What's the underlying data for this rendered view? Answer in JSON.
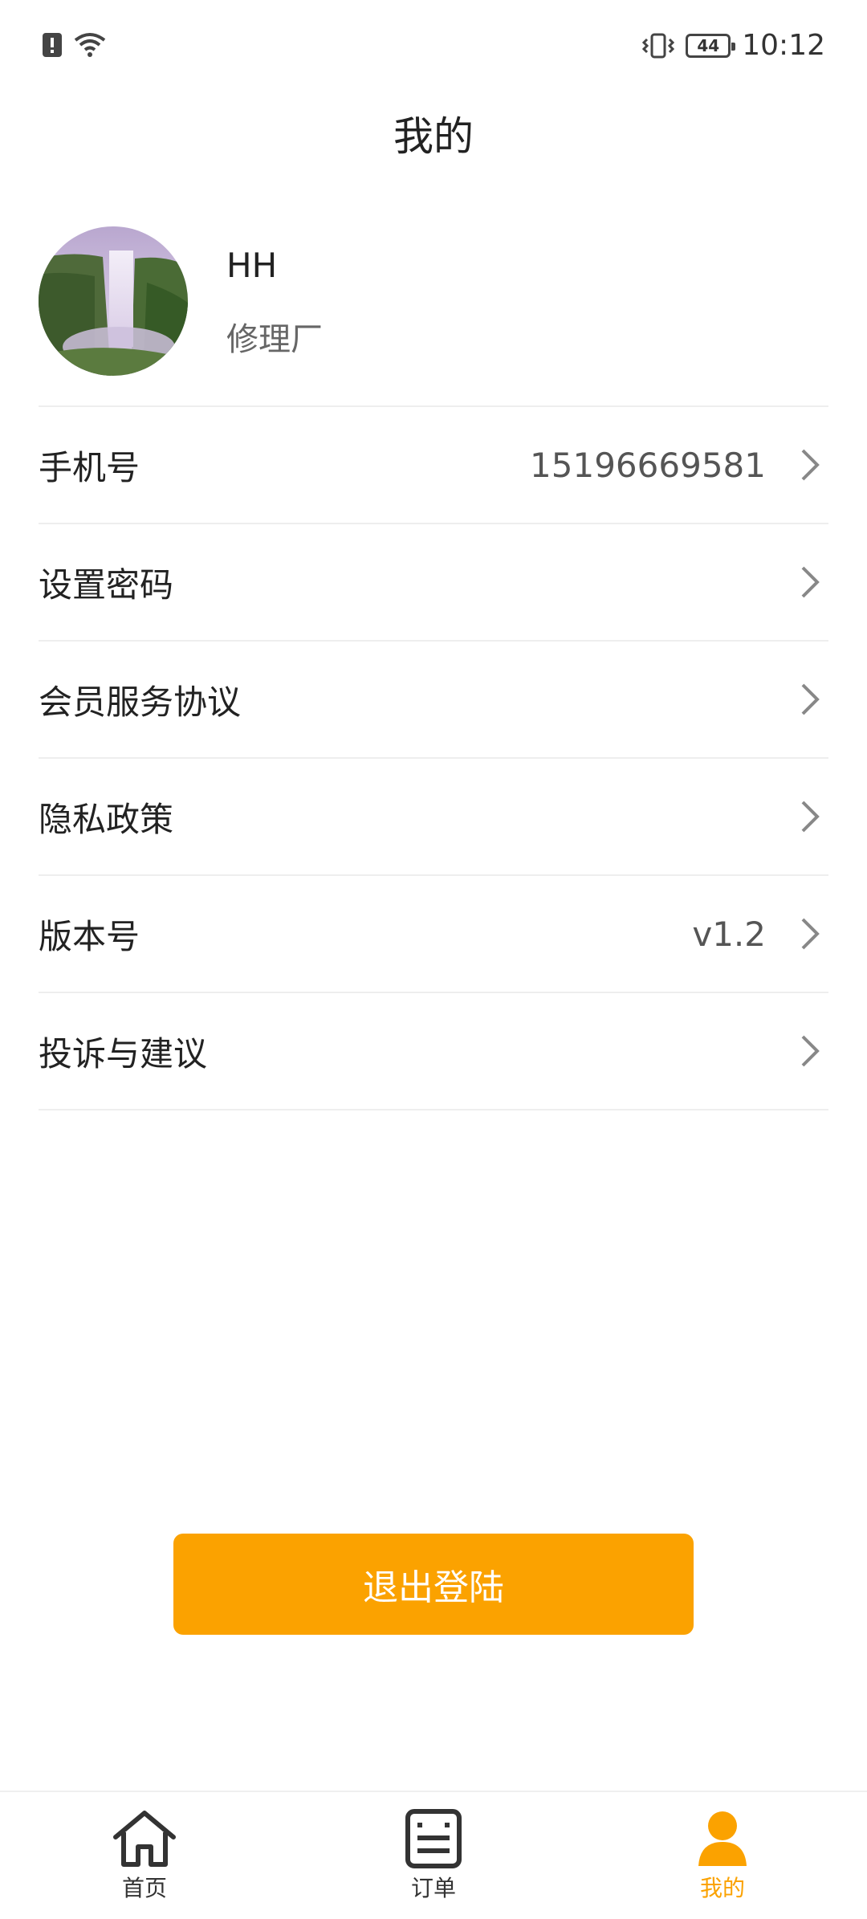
{
  "status_bar": {
    "time": "10:12",
    "battery_level": "44",
    "icons": [
      "alert-icon",
      "wifi-icon",
      "vibrate-icon",
      "battery-icon"
    ]
  },
  "page": {
    "title": "我的"
  },
  "profile": {
    "name": "HH",
    "role": "修理厂",
    "avatar": "waterfall-landscape-photo"
  },
  "menu": {
    "items": [
      {
        "label": "手机号",
        "value": "15196669581"
      },
      {
        "label": "设置密码",
        "value": ""
      },
      {
        "label": "会员服务协议",
        "value": ""
      },
      {
        "label": "隐私政策",
        "value": ""
      },
      {
        "label": "版本号",
        "value": "v1.2"
      },
      {
        "label": "投诉与建议",
        "value": ""
      }
    ]
  },
  "logout": {
    "label": "退出登陆"
  },
  "bottom_nav": {
    "items": [
      {
        "label": "首页",
        "icon": "home-icon",
        "active": false
      },
      {
        "label": "订单",
        "icon": "order-icon",
        "active": false
      },
      {
        "label": "我的",
        "icon": "person-icon",
        "active": true
      }
    ]
  },
  "colors": {
    "accent": "#FBA200",
    "text": "#222222",
    "secondary_text": "#666666",
    "divider": "#EEEEEE"
  }
}
